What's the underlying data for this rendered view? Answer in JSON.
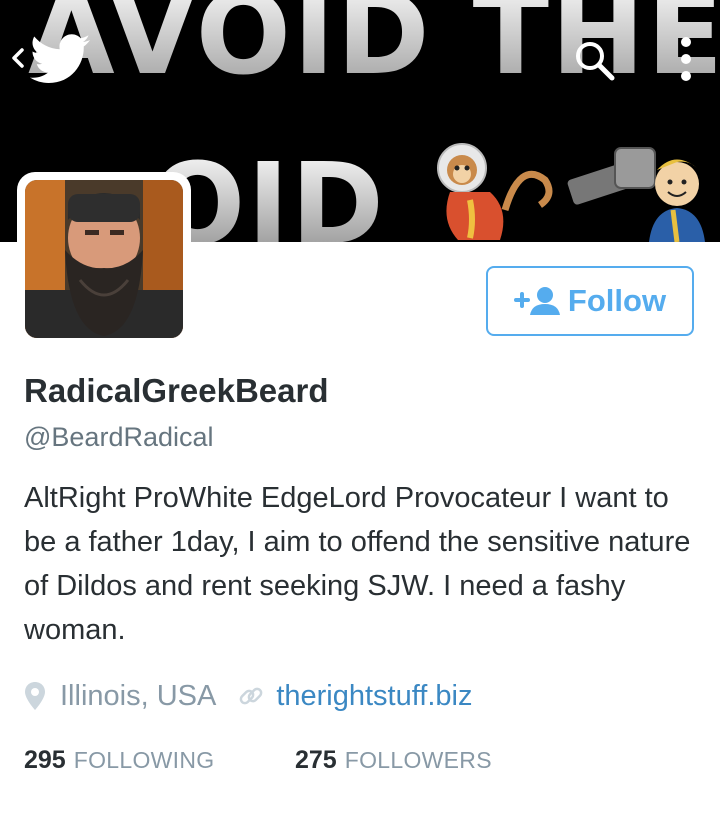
{
  "banner": {
    "line1": "AVOID THE",
    "line2": "OID"
  },
  "icons": {
    "back": "chevron-left-icon",
    "twitter": "twitter-bird-icon",
    "search": "search-icon",
    "more": "more-vertical-icon",
    "location": "location-pin-icon",
    "link": "link-icon",
    "follow": "add-user-icon"
  },
  "colors": {
    "accent": "#55acee",
    "link": "#3b88c3",
    "text": "#292f33",
    "muted": "#8899a6"
  },
  "profile": {
    "display_name": "RadicalGreekBeard",
    "handle": "@BeardRadical",
    "bio": "AltRight ProWhite EdgeLord Provocateur I want to be a father 1day, I aim to offend the sensitive nature of Dildos and rent seeking SJW. I need a fashy woman.",
    "location": "Illinois, USA",
    "website": "therightstuff.biz"
  },
  "follow_button": {
    "label": "Follow"
  },
  "stats": {
    "following_count": "295",
    "following_label": "FOLLOWING",
    "followers_count": "275",
    "followers_label": "FOLLOWERS"
  }
}
